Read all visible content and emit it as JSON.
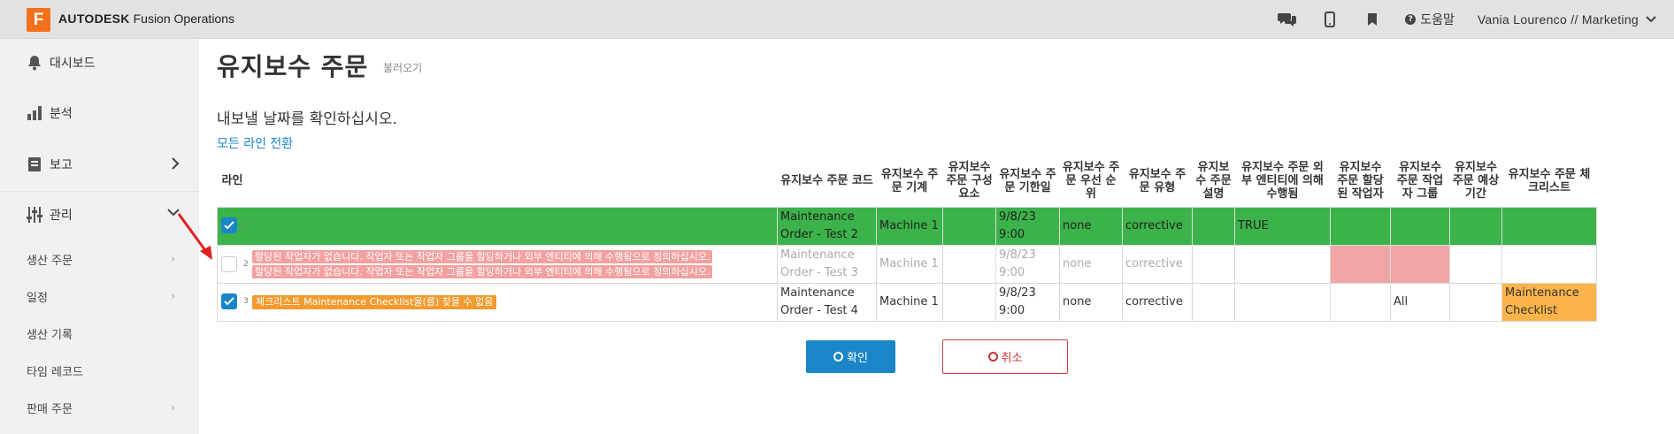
{
  "header": {
    "logo_letter": "F",
    "brand_bold": "AUTODESK",
    "brand_rest": "Fusion Operations",
    "help_label": "도움말",
    "user_label": "Vania Lourenco // Marketing"
  },
  "sidebar": {
    "items": [
      {
        "label": "대시보드",
        "icon": "bell-icon"
      },
      {
        "label": "분석",
        "icon": "bar-chart-icon"
      },
      {
        "label": "보고",
        "icon": "report-icon"
      },
      {
        "label": "관리",
        "icon": "sliders-icon"
      }
    ],
    "sub_items": [
      {
        "label": "생산 주문"
      },
      {
        "label": "일정"
      },
      {
        "label": "생산 기록"
      },
      {
        "label": "타임 레코드"
      },
      {
        "label": "판매 주문"
      }
    ]
  },
  "main": {
    "title": "유지보수 주문",
    "subtitle": "불러오기",
    "prompt": "내보낼 날짜를 확인하십시오.",
    "toggle_all": "모든 라인 전환",
    "table": {
      "headers": [
        "라인",
        "유지보수 주문 코드",
        "유지보수 주문 기계",
        "유지보수 주문 구성 요소",
        "유지보수 주문 기한일",
        "유지보수 주문 우선 순위",
        "유지보수 주문 유형",
        "유지보수 주문 설명",
        "유지보수 주문 외부 엔티티에 의해 수행됨",
        "유지보수 주문 할당된 작업자",
        "유지보수 주문 작업자 그룹",
        "유지보수 주문 예상 기간",
        "유지보수 주문 체크리스트"
      ],
      "rows": [
        {
          "num": "1",
          "checked": true,
          "messages": [],
          "code": "Maintenance Order - Test 2",
          "machine": "Machine 1",
          "component": "",
          "due": "9/8/23 9:00",
          "priority": "none",
          "type": "corrective",
          "description": "",
          "external": "TRUE",
          "worker": "",
          "group": "",
          "duration": "",
          "checklist": ""
        },
        {
          "num": "2",
          "checked": false,
          "messages": [
            "할당된 작업자가 없습니다. 작업자 또는 작업자 그룹을 할당하거나 외부 엔티티에 의해 수행됨으로 정의하십시오.",
            "할당된 작업자가 없습니다. 작업자 또는 작업자 그룹을 할당하거나 외부 엔티티에 의해 수행됨으로 정의하십시오."
          ],
          "code": "Maintenance Order - Test 3",
          "machine": "Machine 1",
          "component": "",
          "due": "9/8/23 9:00",
          "priority": "none",
          "type": "corrective",
          "description": "",
          "external": "",
          "worker": "",
          "group": "",
          "duration": "",
          "checklist": ""
        },
        {
          "num": "3",
          "checked": true,
          "messages": [
            "체크리스트 Maintenance Checklist을(를) 찾을 수 없음"
          ],
          "code": "Maintenance Order - Test 4",
          "machine": "Machine 1",
          "component": "",
          "due": "9/8/23 9:00",
          "priority": "none",
          "type": "corrective",
          "description": "",
          "external": "",
          "worker": "",
          "group": "All",
          "duration": "",
          "checklist": "Maintenance Checklist"
        }
      ]
    },
    "ok_label": "확인",
    "cancel_label": "취소"
  },
  "colors": {
    "accent": "#1a86c8",
    "success_row": "#3cb34a",
    "error_cell": "#f2a5a5",
    "warning_cell": "#fbb44a",
    "logo": "#f2711c"
  }
}
